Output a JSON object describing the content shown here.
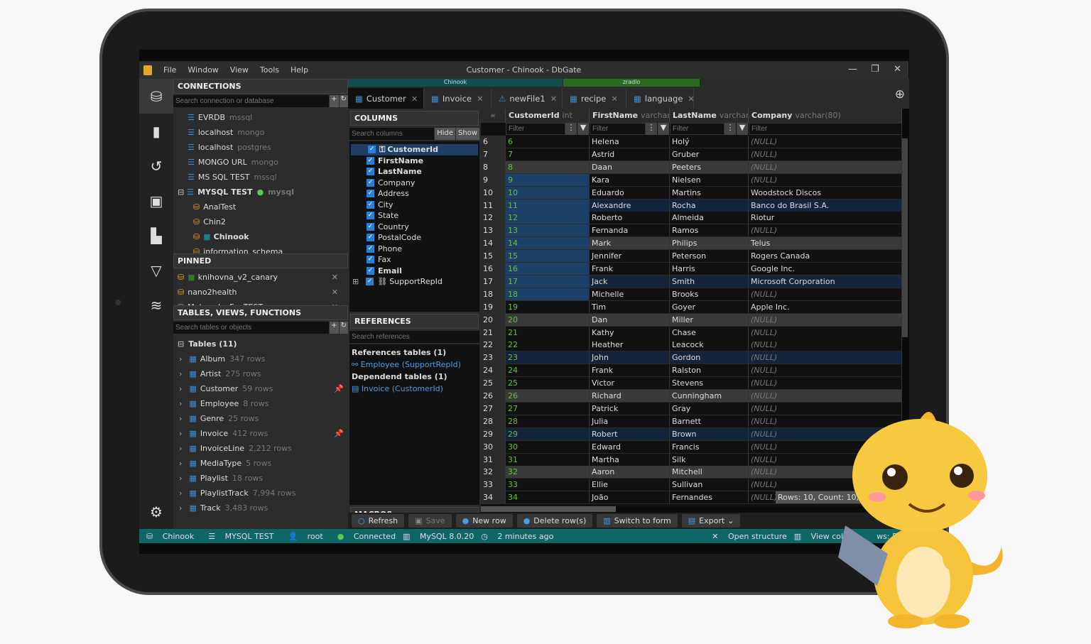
{
  "window": {
    "title": "Customer - Chinook - DbGate",
    "menu": [
      "File",
      "Window",
      "View",
      "Tools",
      "Help"
    ]
  },
  "connections": {
    "header": "CONNECTIONS",
    "search_placeholder": "Search connection or database",
    "items": [
      {
        "name": "EVRDB",
        "engine": "mssql"
      },
      {
        "name": "localhost",
        "engine": "mongo"
      },
      {
        "name": "localhost",
        "engine": "postgres"
      },
      {
        "name": "MONGO URL",
        "engine": "mongo"
      },
      {
        "name": "MS SQL TEST",
        "engine": "mssql"
      },
      {
        "name": "MYSQL TEST",
        "engine": "mysql"
      }
    ],
    "databases": [
      "AnalTest",
      "Chin2",
      "Chinook",
      "information_schema"
    ]
  },
  "pinned": {
    "header": "PINNED",
    "items": [
      "knihovna_v2_canary",
      "nano2health",
      "Mohnacky FunTEST"
    ]
  },
  "tables": {
    "header": "TABLES, VIEWS, FUNCTIONS",
    "search_placeholder": "Search tables or objects",
    "group": "Tables (11)",
    "items": [
      {
        "name": "Album",
        "rows": "347 rows"
      },
      {
        "name": "Artist",
        "rows": "275 rows"
      },
      {
        "name": "Customer",
        "rows": "59 rows",
        "pinned": true
      },
      {
        "name": "Employee",
        "rows": "8 rows"
      },
      {
        "name": "Genre",
        "rows": "25 rows"
      },
      {
        "name": "Invoice",
        "rows": "412 rows",
        "pinned": true
      },
      {
        "name": "InvoiceLine",
        "rows": "2,212 rows"
      },
      {
        "name": "MediaType",
        "rows": "5 rows"
      },
      {
        "name": "Playlist",
        "rows": "18 rows"
      },
      {
        "name": "PlaylistTrack",
        "rows": "7,994 rows"
      },
      {
        "name": "Track",
        "rows": "3,483 rows"
      }
    ]
  },
  "tab_groups": [
    {
      "label": "Chinook",
      "color": "#124f4f"
    },
    {
      "label": "zradlo",
      "color": "#2a6b1f"
    }
  ],
  "tabs": [
    {
      "label": "Customer",
      "active": true
    },
    {
      "label": "Invoice"
    },
    {
      "label": "newFile1"
    },
    {
      "label": "recipe"
    },
    {
      "label": "language"
    }
  ],
  "columns_panel": {
    "header": "COLUMNS",
    "search_placeholder": "Search columns",
    "hide": "Hide",
    "show": "Show",
    "items": [
      "CustomerId",
      "FirstName",
      "LastName",
      "Company",
      "Address",
      "City",
      "State",
      "Country",
      "PostalCode",
      "Phone",
      "Fax",
      "Email",
      "SupportRepId"
    ]
  },
  "references": {
    "header": "REFERENCES",
    "search_placeholder": "Search references",
    "ref_title": "References tables (1)",
    "ref_item": "Employee (SupportRepId)",
    "dep_title": "Dependend tables (1)",
    "dep_item": "Invoice (CustomerId)"
  },
  "macros": {
    "header": "MACROS"
  },
  "grid": {
    "headers": [
      {
        "name": "CustomerId",
        "type": "int"
      },
      {
        "name": "FirstName",
        "type": "varchar"
      },
      {
        "name": "LastName",
        "type": "varchar"
      },
      {
        "name": "Company",
        "type": "varchar(80)"
      }
    ],
    "filter_placeholder": "Filter",
    "null": "(NULL)",
    "rows": [
      [
        6,
        "Helena",
        "Holý",
        null
      ],
      [
        7,
        "Astrid",
        "Gruber",
        null
      ],
      [
        8,
        "Daan",
        "Peeters",
        null
      ],
      [
        9,
        "Kara",
        "Nielsen",
        null
      ],
      [
        10,
        "Eduardo",
        "Martins",
        "Woodstock Discos"
      ],
      [
        11,
        "Alexandre",
        "Rocha",
        "Banco do Brasil S.A."
      ],
      [
        12,
        "Roberto",
        "Almeida",
        "Riotur"
      ],
      [
        13,
        "Fernanda",
        "Ramos",
        null
      ],
      [
        14,
        "Mark",
        "Philips",
        "Telus"
      ],
      [
        15,
        "Jennifer",
        "Peterson",
        "Rogers Canada"
      ],
      [
        16,
        "Frank",
        "Harris",
        "Google Inc."
      ],
      [
        17,
        "Jack",
        "Smith",
        "Microsoft Corporation"
      ],
      [
        18,
        "Michelle",
        "Brooks",
        null
      ],
      [
        19,
        "Tim",
        "Goyer",
        "Apple Inc."
      ],
      [
        20,
        "Dan",
        "Miller",
        null
      ],
      [
        21,
        "Kathy",
        "Chase",
        null
      ],
      [
        22,
        "Heather",
        "Leacock",
        null
      ],
      [
        23,
        "John",
        "Gordon",
        null
      ],
      [
        24,
        "Frank",
        "Ralston",
        null
      ],
      [
        25,
        "Victor",
        "Stevens",
        null
      ],
      [
        26,
        "Richard",
        "Cunningham",
        null
      ],
      [
        27,
        "Patrick",
        "Gray",
        null
      ],
      [
        28,
        "Julia",
        "Barnett",
        null
      ],
      [
        29,
        "Robert",
        "Brown",
        null
      ],
      [
        30,
        "Edward",
        "Francis",
        null
      ],
      [
        31,
        "Martha",
        "Silk",
        null
      ],
      [
        32,
        "Aaron",
        "Mitchell",
        null
      ],
      [
        33,
        "Ellie",
        "Sullivan",
        null
      ],
      [
        34,
        "João",
        "Fernandes",
        null
      ]
    ],
    "summary": "Rows: 10, Count: 10, Sum"
  },
  "toolbar": [
    "Refresh",
    "Save",
    "New row",
    "Delete row(s)",
    "Switch to form",
    "Export"
  ],
  "status": {
    "db": "Chinook",
    "conn": "MYSQL TEST",
    "user": "root",
    "state": "Connected",
    "version": "MySQL 8.0.20",
    "time": "2 minutes ago",
    "open_structure": "Open structure",
    "view_columns": "View colu",
    "rows": "ws: 59"
  }
}
